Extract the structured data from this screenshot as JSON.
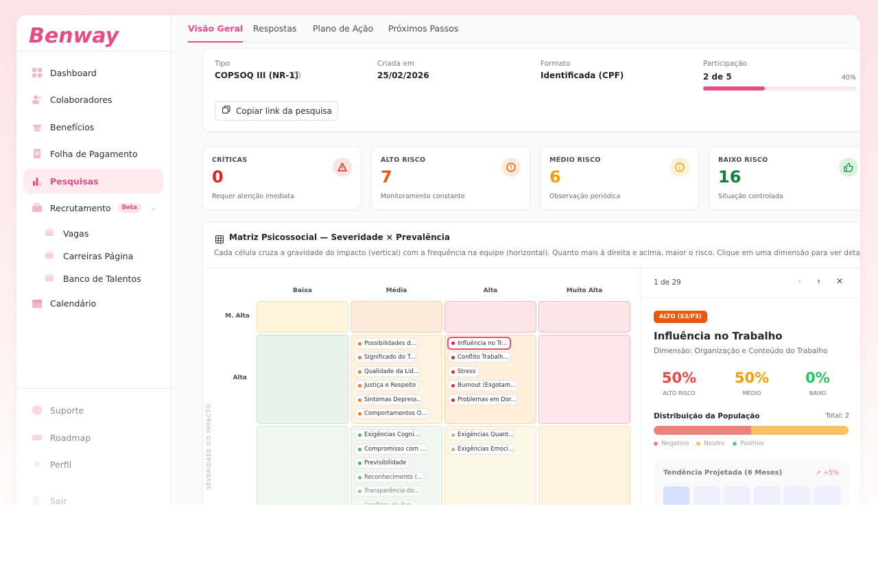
{
  "brand": {
    "logo": "Benway",
    "accent": "#e84a86"
  },
  "sidebar": {
    "items": [
      {
        "label": "Dashboard",
        "icon": "grid-icon"
      },
      {
        "label": "Colaboradores",
        "icon": "users-icon"
      },
      {
        "label": "Benefícios",
        "icon": "gift-icon"
      },
      {
        "label": "Folha de Pagamento",
        "icon": "document-icon"
      },
      {
        "label": "Pesquisas",
        "icon": "bar-chart-icon",
        "active": true
      },
      {
        "label": "Recrutamento",
        "icon": "briefcase-icon",
        "badge": "Beta"
      },
      {
        "label": "Vagas",
        "icon": "briefcase-icon"
      },
      {
        "label": "Carreiras Página",
        "icon": "briefcase-icon"
      },
      {
        "label": "Banco de Talentos",
        "icon": "briefcase-icon"
      },
      {
        "label": "Calendário",
        "icon": "calendar-icon"
      }
    ],
    "bottom": [
      {
        "label": "Suporte",
        "icon": "help-icon"
      },
      {
        "label": "Roadmap",
        "icon": "map-icon"
      },
      {
        "label": "Perfil",
        "icon": "user-icon"
      },
      {
        "label": "Sair",
        "icon": "logout-icon"
      }
    ]
  },
  "tabs": [
    "Visão Geral",
    "Respostas",
    "Plano de Ação",
    "Próximos Passos"
  ],
  "info": {
    "tipo_label": "Tipo",
    "tipo_value": "COPSOQ III (NR-1)",
    "criada_label": "Criada em",
    "criada_value": "25/02/2026",
    "formato_label": "Formato",
    "formato_value": "Identificada (CPF)",
    "participacao_label": "Participação",
    "participacao_value": "2 de 5",
    "participacao_pct": "40%",
    "participacao_fraction": 0.4,
    "copy_button": "Copiar link da pesquisa"
  },
  "stats": [
    {
      "label": "CRÍTICAS",
      "value": "0",
      "desc": "Requer atenção imediata",
      "color": "#dc2626",
      "icon": "alert-triangle-icon",
      "icon_bg": "#fde4e4"
    },
    {
      "label": "ALTO RISCO",
      "value": "7",
      "desc": "Monitoramento constante",
      "color": "#ea580c",
      "icon": "alert-circle-icon",
      "icon_bg": "#fdebd9"
    },
    {
      "label": "MÉDIO RISCO",
      "value": "6",
      "desc": "Observação periódica",
      "color": "#f59e0b",
      "icon": "info-circle-icon",
      "icon_bg": "#fdf1d6"
    },
    {
      "label": "BAIXO RISCO",
      "value": "16",
      "desc": "Situação controlada",
      "color": "#15803d",
      "icon": "thumbs-up-icon",
      "icon_bg": "#ddf3e2"
    }
  ],
  "matrix": {
    "title": "Matriz Psicossocial — Severidade × Prevalência",
    "description": "Cada célula cruza a gravidade do impacto (vertical) com a frequência na equipe (horizontal). Quanto mais à direita e acima, maior o risco. Clique em uma dimensão para ver detalhes.",
    "columns": [
      "Baixa",
      "Média",
      "Alta",
      "Muito Alta"
    ],
    "rows": [
      "M. Alta",
      "Alta"
    ],
    "y_axis": "SEVERIDADE DO IMPACTO",
    "alta_media": [
      "Possibilidades d...",
      "Significado do T...",
      "Qualidade da Lid...",
      "Justiça e Respeito",
      "Sintomas Depress...",
      "Comportamentos O..."
    ],
    "alta_alta": [
      "Influência no Tr...",
      "Conflito Trabalh...",
      "Stress",
      "Burnout (Esgotam...",
      "Problemas em Dor..."
    ],
    "media_media": [
      "Exigências Cogni...",
      "Compromisso com ...",
      "Previsibilidade",
      "Reconhecimento (...",
      "Transparência do...",
      "Conflitos de Pap..."
    ],
    "media_alta": [
      "Exigências Quant...",
      "Exigências Emoci..."
    ]
  },
  "detail": {
    "count": "1 de 29",
    "badge": "ALTO (S3/P3)",
    "title": "Influência no Trabalho",
    "subtitle": "Dimensão: Organização e Conteúdo do Trabalho",
    "metrics": [
      {
        "value": "50%",
        "label": "ALTO RISCO",
        "color": "#ef4444"
      },
      {
        "value": "50%",
        "label": "MÉDIO",
        "color": "#f59e0b"
      },
      {
        "value": "0%",
        "label": "BAIXO",
        "color": "#22c55e"
      }
    ],
    "dist_title": "Distribuição da População",
    "dist_total": "Total: 2",
    "distribution": {
      "negativo": 0.5,
      "neutro": 0.5,
      "positivo": 0
    },
    "legend": [
      "Negativo",
      "Neutro",
      "Positivo"
    ],
    "trend_title": "Tendência Projetada (6 Meses)",
    "trend_pct": "+5%"
  }
}
